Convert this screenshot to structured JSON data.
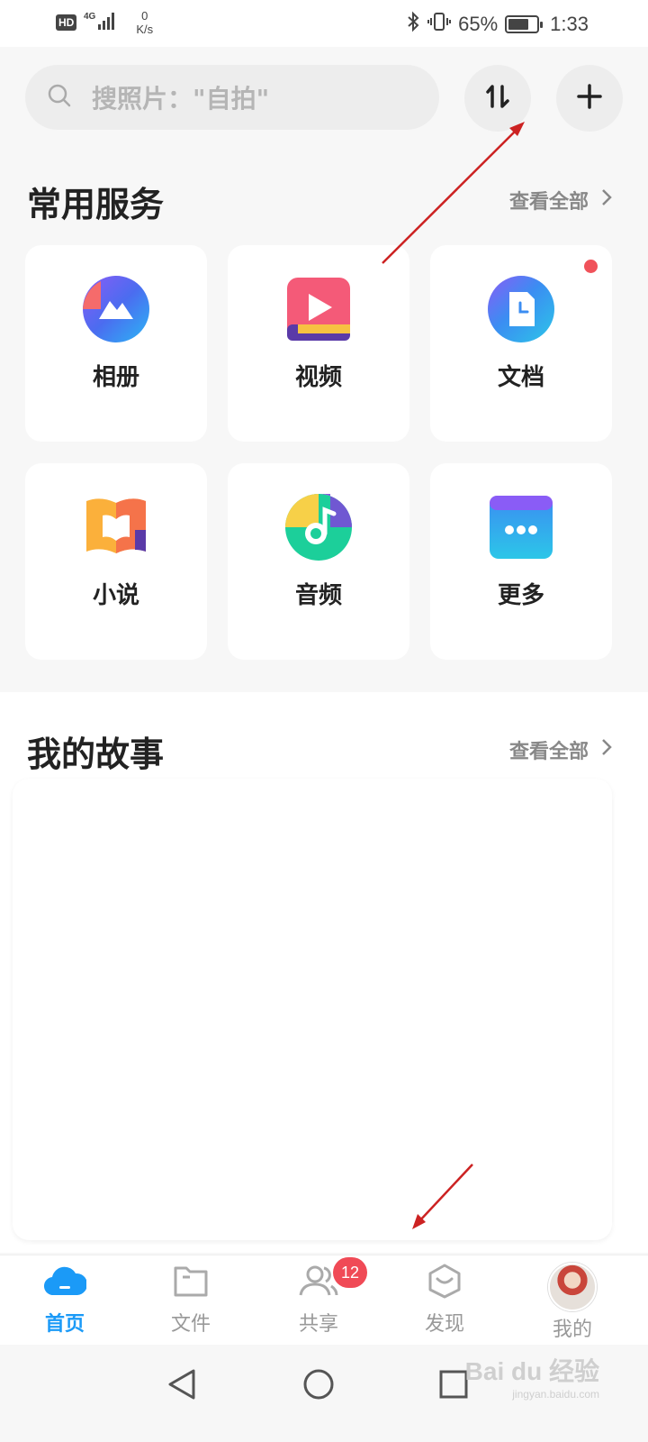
{
  "status_bar": {
    "hd": "HD",
    "network": "4G",
    "speed_value": "0",
    "speed_unit": "K/s",
    "battery_pct": "65%",
    "time": "1:33"
  },
  "search": {
    "placeholder": "搜照片：\"自拍\""
  },
  "services": {
    "title": "常用服务",
    "view_all": "查看全部",
    "items": [
      {
        "label": "相册",
        "icon": "album-icon"
      },
      {
        "label": "视频",
        "icon": "video-icon"
      },
      {
        "label": "文档",
        "icon": "document-icon"
      },
      {
        "label": "小说",
        "icon": "novel-icon"
      },
      {
        "label": "音频",
        "icon": "audio-icon"
      },
      {
        "label": "更多",
        "icon": "more-icon"
      }
    ]
  },
  "stories": {
    "title": "我的故事",
    "view_all": "查看全部"
  },
  "tabs": [
    {
      "label": "首页",
      "icon": "cloud-icon",
      "active": true
    },
    {
      "label": "文件",
      "icon": "folder-icon"
    },
    {
      "label": "共享",
      "icon": "share-users-icon",
      "badge": "12"
    },
    {
      "label": "发现",
      "icon": "discover-icon"
    },
    {
      "label": "我的",
      "icon": "avatar"
    }
  ],
  "watermark": {
    "text": "Bai du 经验",
    "sub": "jingyan.baidu.com"
  },
  "colors": {
    "accent": "#1b9af7",
    "badge": "#f04a56",
    "annotation_arrow": "#cc2222"
  }
}
